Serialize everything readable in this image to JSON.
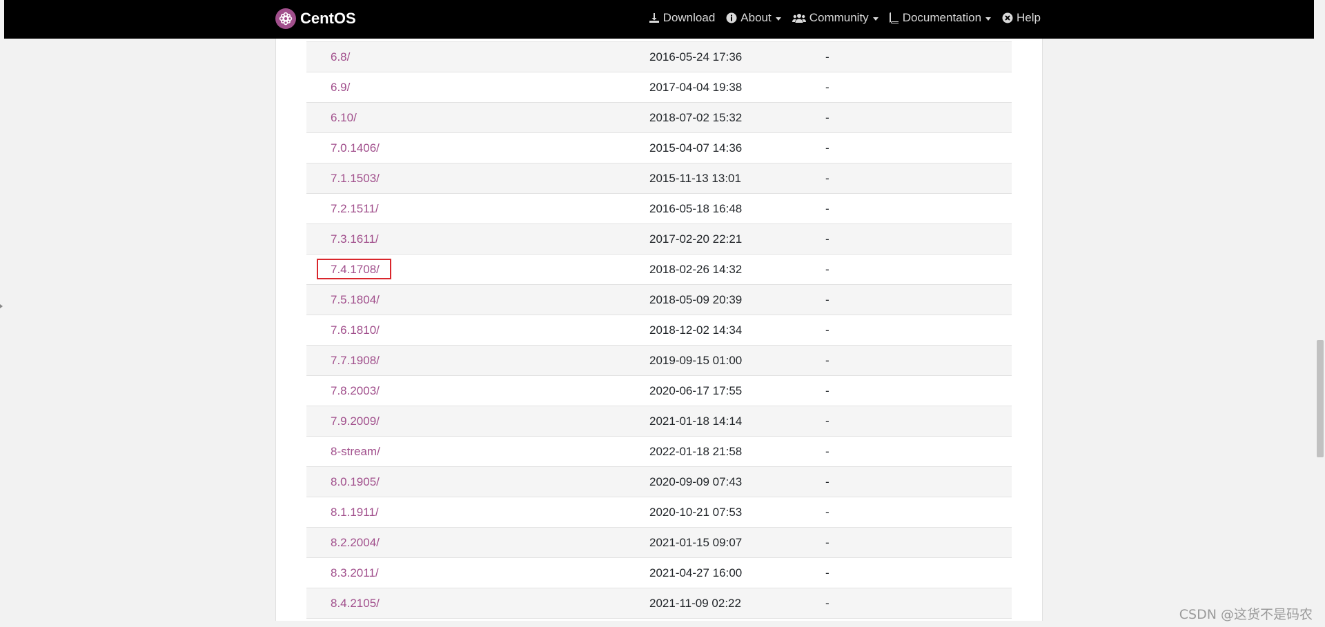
{
  "navbar": {
    "brand": "CentOS",
    "items": [
      {
        "label": "Download",
        "icon": "download-icon",
        "dropdown": false
      },
      {
        "label": "About",
        "icon": "info-icon",
        "dropdown": true
      },
      {
        "label": "Community",
        "icon": "users-icon",
        "dropdown": true
      },
      {
        "label": "Documentation",
        "icon": "book-icon",
        "dropdown": true
      },
      {
        "label": "Help",
        "icon": "help-icon",
        "dropdown": false
      }
    ]
  },
  "listing": {
    "rows": [
      {
        "name": "6.8/",
        "date": "2016-05-24 17:36",
        "size": "-"
      },
      {
        "name": "6.9/",
        "date": "2017-04-04 19:38",
        "size": "-"
      },
      {
        "name": "6.10/",
        "date": "2018-07-02 15:32",
        "size": "-"
      },
      {
        "name": "7.0.1406/",
        "date": "2015-04-07 14:36",
        "size": "-"
      },
      {
        "name": "7.1.1503/",
        "date": "2015-11-13 13:01",
        "size": "-"
      },
      {
        "name": "7.2.1511/",
        "date": "2016-05-18 16:48",
        "size": "-"
      },
      {
        "name": "7.3.1611/",
        "date": "2017-02-20 22:21",
        "size": "-"
      },
      {
        "name": "7.4.1708/",
        "date": "2018-02-26 14:32",
        "size": "-",
        "highlighted": true
      },
      {
        "name": "7.5.1804/",
        "date": "2018-05-09 20:39",
        "size": "-"
      },
      {
        "name": "7.6.1810/",
        "date": "2018-12-02 14:34",
        "size": "-"
      },
      {
        "name": "7.7.1908/",
        "date": "2019-09-15 01:00",
        "size": "-"
      },
      {
        "name": "7.8.2003/",
        "date": "2020-06-17 17:55",
        "size": "-"
      },
      {
        "name": "7.9.2009/",
        "date": "2021-01-18 14:14",
        "size": "-"
      },
      {
        "name": "8-stream/",
        "date": "2022-01-18 21:58",
        "size": "-"
      },
      {
        "name": "8.0.1905/",
        "date": "2020-09-09 07:43",
        "size": "-"
      },
      {
        "name": "8.1.1911/",
        "date": "2020-10-21 07:53",
        "size": "-"
      },
      {
        "name": "8.2.2004/",
        "date": "2021-01-15 09:07",
        "size": "-"
      },
      {
        "name": "8.3.2011/",
        "date": "2021-04-27 16:00",
        "size": "-"
      },
      {
        "name": "8.4.2105/",
        "date": "2021-11-09 02:22",
        "size": "-"
      }
    ]
  },
  "watermark": "CSDN @这货不是码农",
  "colors": {
    "link": "#a14f8c",
    "navbar_bg": "#000000",
    "highlight_border": "#d9262c"
  }
}
